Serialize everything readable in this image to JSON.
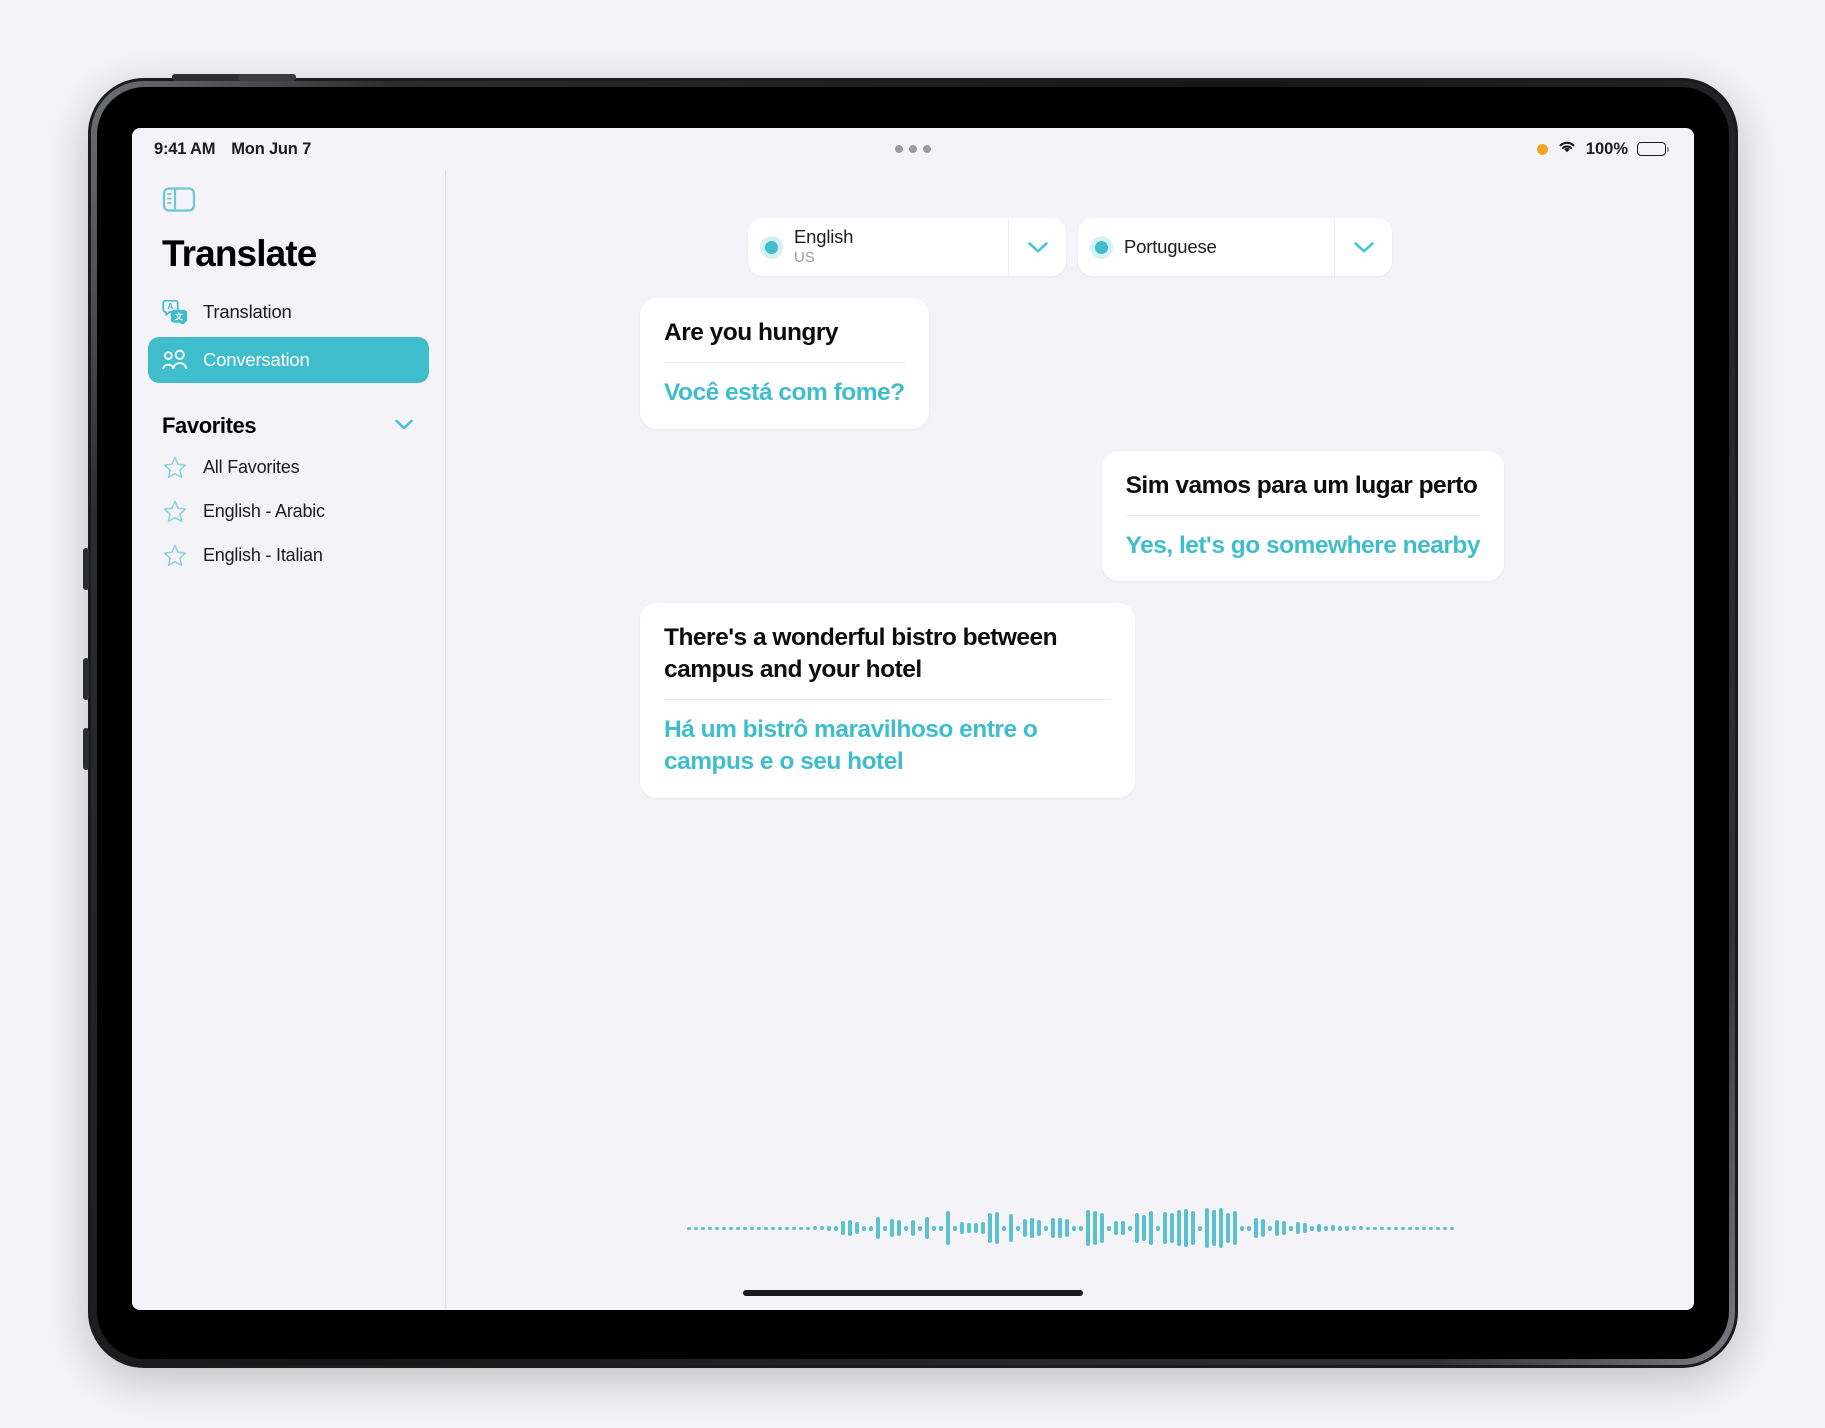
{
  "statusbar": {
    "time": "9:41 AM",
    "date": "Mon Jun 7",
    "battery_percent": "100%",
    "mic_indicator": "orange-dot",
    "wifi_icon": "wifi-icon",
    "battery_icon": "battery-icon",
    "multitask_handle": "three-dots"
  },
  "sidebar": {
    "toggle_icon": "sidebar-toggle-icon",
    "title": "Translate",
    "nav": [
      {
        "label": "Translation",
        "icon": "translation-icon",
        "selected": false
      },
      {
        "label": "Conversation",
        "icon": "conversation-people-icon",
        "selected": true
      }
    ],
    "section": {
      "title": "Favorites",
      "chevron": "chevron-down-icon"
    },
    "favorites": [
      {
        "label": "All Favorites",
        "icon": "star-icon"
      },
      {
        "label": "English - Arabic",
        "icon": "star-icon"
      },
      {
        "label": "English - Italian",
        "icon": "star-icon"
      }
    ]
  },
  "main": {
    "languages": {
      "source": {
        "name": "English",
        "region": "US",
        "dot": "active-dot",
        "chevron": "chevron-down-icon"
      },
      "target": {
        "name": "Portuguese",
        "region": "",
        "dot": "active-dot",
        "chevron": "chevron-down-icon"
      }
    },
    "messages": [
      {
        "side": "left",
        "source": "Are you hungry",
        "target": "Você está com fome?"
      },
      {
        "side": "right",
        "source": "Sim vamos para um lugar perto",
        "target": "Yes, let's go somewhere nearby"
      },
      {
        "side": "left",
        "source": "There's a wonderful bistro between campus and your hotel",
        "target": "Há um bistrô maravilhoso entre o campus e o seu hotel"
      }
    ],
    "waveform": {
      "name": "audio-waveform",
      "heights": [
        3,
        3,
        3,
        3,
        3,
        3,
        3,
        3,
        3,
        3,
        3,
        3,
        3,
        3,
        3,
        3,
        3,
        3,
        4,
        4,
        5,
        5,
        14,
        16,
        12,
        5,
        5,
        22,
        5,
        18,
        16,
        5,
        16,
        5,
        22,
        5,
        5,
        34,
        5,
        12,
        10,
        10,
        12,
        30,
        32,
        5,
        28,
        5,
        18,
        20,
        16,
        5,
        20,
        20,
        18,
        5,
        5,
        36,
        34,
        30,
        5,
        14,
        14,
        5,
        30,
        26,
        34,
        5,
        32,
        30,
        36,
        38,
        34,
        5,
        40,
        36,
        40,
        30,
        34,
        5,
        5,
        20,
        18,
        5,
        16,
        14,
        5,
        12,
        10,
        5,
        8,
        5,
        6,
        5,
        5,
        4,
        4,
        3,
        3,
        3,
        3,
        3,
        3,
        3,
        3,
        3,
        3,
        3,
        3,
        3
      ]
    }
  },
  "colors": {
    "accent": "#3fbdcd",
    "selected_nav_bg": "#3fbdcd",
    "background": "#f3f3f8",
    "bubble_bg": "#ffffff",
    "text_primary": "#0d0d0f",
    "mic_orange": "#f4a322"
  }
}
